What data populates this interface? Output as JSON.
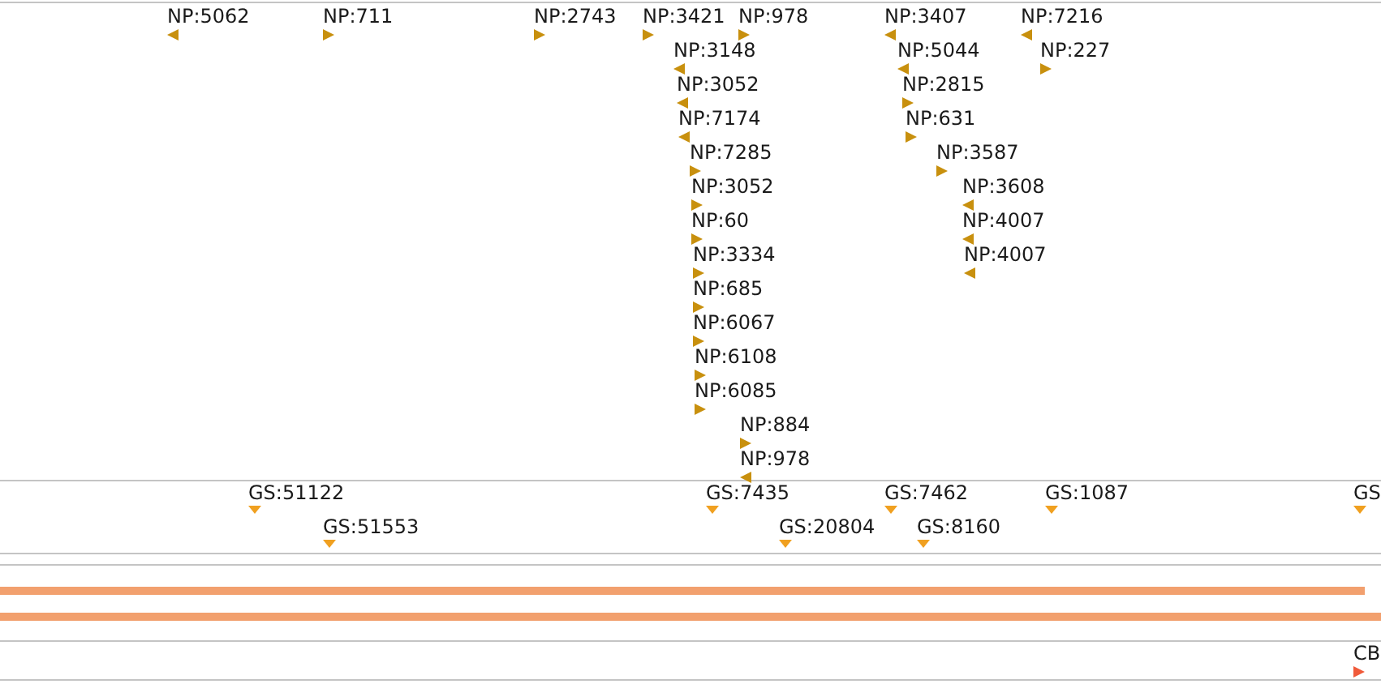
{
  "tracks": [
    {
      "kind": "np",
      "lanes": [
        [
          {
            "label": "NP:5062",
            "kind": "reverse"
          },
          {
            "label": "NP:711",
            "kind": "forward"
          },
          {
            "label": "NP:2743",
            "kind": "forward"
          },
          {
            "label": "NP:3421",
            "kind": "forward"
          },
          {
            "label": "NP:978",
            "kind": "forward"
          },
          {
            "label": "NP:3407",
            "kind": "reverse"
          },
          {
            "label": "NP:7216",
            "kind": "reverse"
          }
        ],
        [
          {
            "label": "NP:3148",
            "kind": "reverse"
          },
          {
            "label": "NP:5044",
            "kind": "reverse"
          },
          {
            "label": "NP:227",
            "kind": "forward"
          }
        ],
        [
          {
            "label": "NP:3052",
            "kind": "reverse"
          },
          {
            "label": "NP:2815",
            "kind": "forward"
          }
        ],
        [
          {
            "label": "NP:7174",
            "kind": "reverse"
          },
          {
            "label": "NP:631",
            "kind": "forward"
          }
        ],
        [
          {
            "label": "NP:7285",
            "kind": "forward"
          },
          {
            "label": "NP:3587",
            "kind": "forward"
          }
        ],
        [
          {
            "label": "NP:3052",
            "kind": "forward"
          },
          {
            "label": "NP:3608",
            "kind": "reverse"
          }
        ],
        [
          {
            "label": "NP:60",
            "kind": "forward"
          },
          {
            "label": "NP:4007",
            "kind": "reverse"
          }
        ],
        [
          {
            "label": "NP:3334",
            "kind": "forward"
          },
          {
            "label": "NP:4007",
            "kind": "reverse"
          }
        ],
        [
          {
            "label": "NP:685",
            "kind": "forward"
          }
        ],
        [
          {
            "label": "NP:6067",
            "kind": "forward"
          }
        ],
        [
          {
            "label": "NP:6108",
            "kind": "forward"
          }
        ],
        [
          {
            "label": "NP:6085",
            "kind": "forward"
          }
        ],
        [
          {
            "label": "NP:884",
            "kind": "forward"
          }
        ],
        [
          {
            "label": "NP:978",
            "kind": "reverse"
          }
        ]
      ]
    },
    {
      "kind": "gs",
      "lanes": [
        [
          {
            "label": "GS:51122",
            "kind": "point"
          },
          {
            "label": "GS:7435",
            "kind": "point"
          },
          {
            "label": "GS:7462",
            "kind": "point"
          },
          {
            "label": "GS:1087",
            "kind": "point"
          },
          {
            "label": "GS",
            "kind": "point"
          }
        ],
        [
          {
            "label": "GS:51553",
            "kind": "point"
          },
          {
            "label": "GS:20804",
            "kind": "point"
          },
          {
            "label": "GS:8160",
            "kind": "point"
          }
        ]
      ]
    },
    {
      "kind": "bars",
      "bars": [
        {
          "extends_past_edge": false
        },
        {
          "extends_past_edge": true
        }
      ]
    },
    {
      "kind": "cb",
      "lanes": [
        [
          {
            "label": "CB",
            "kind": "forward"
          }
        ]
      ]
    }
  ]
}
